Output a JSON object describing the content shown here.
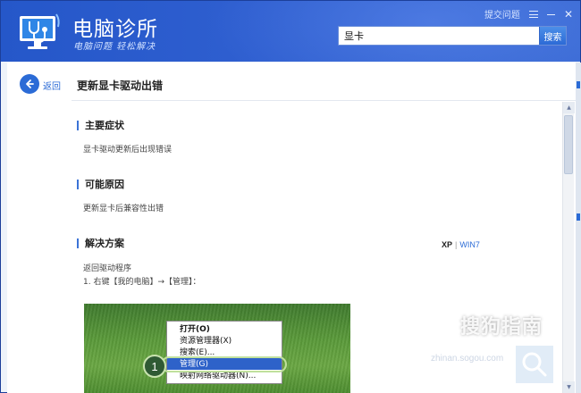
{
  "header": {
    "app_title": "电脑诊所",
    "app_subtitle": "电脑问题 轻松解决",
    "feedback_label": "提交问题",
    "search_value": "显卡",
    "search_button": "搜索"
  },
  "nav": {
    "back_label": "返回"
  },
  "article": {
    "title": "更新显卡驱动出错",
    "sections": [
      {
        "heading": "主要症状",
        "text": "显卡驱动更新后出现错误"
      },
      {
        "heading": "可能原因",
        "text": "更新显卡后兼容性出错"
      },
      {
        "heading": "解决方案",
        "text": ""
      }
    ],
    "os_tabs": {
      "xp": "XP",
      "separator": "|",
      "win7": "WIN7"
    },
    "solution_line1": "返回驱动程序",
    "solution_line2": "1. 右键【我的电脑】→【管理】："
  },
  "screenshot": {
    "step_number": "1",
    "menu_items": [
      {
        "label": "打开(O)",
        "bold": true
      },
      {
        "label": "资源管理器(X)",
        "bold": false
      },
      {
        "label": "搜索(E)...",
        "bold": false
      },
      {
        "label": "管理(G)",
        "bold": false,
        "highlighted": true
      },
      {
        "label": "映射网络驱动器(N)...",
        "bold": false
      }
    ]
  },
  "watermark": {
    "brand": "搜狗指南",
    "url": "zhinan.sogou.com"
  },
  "colors": {
    "header_blue": "#2557c9",
    "accent_blue": "#2b6bd6",
    "selection_blue": "#2e62c9"
  }
}
